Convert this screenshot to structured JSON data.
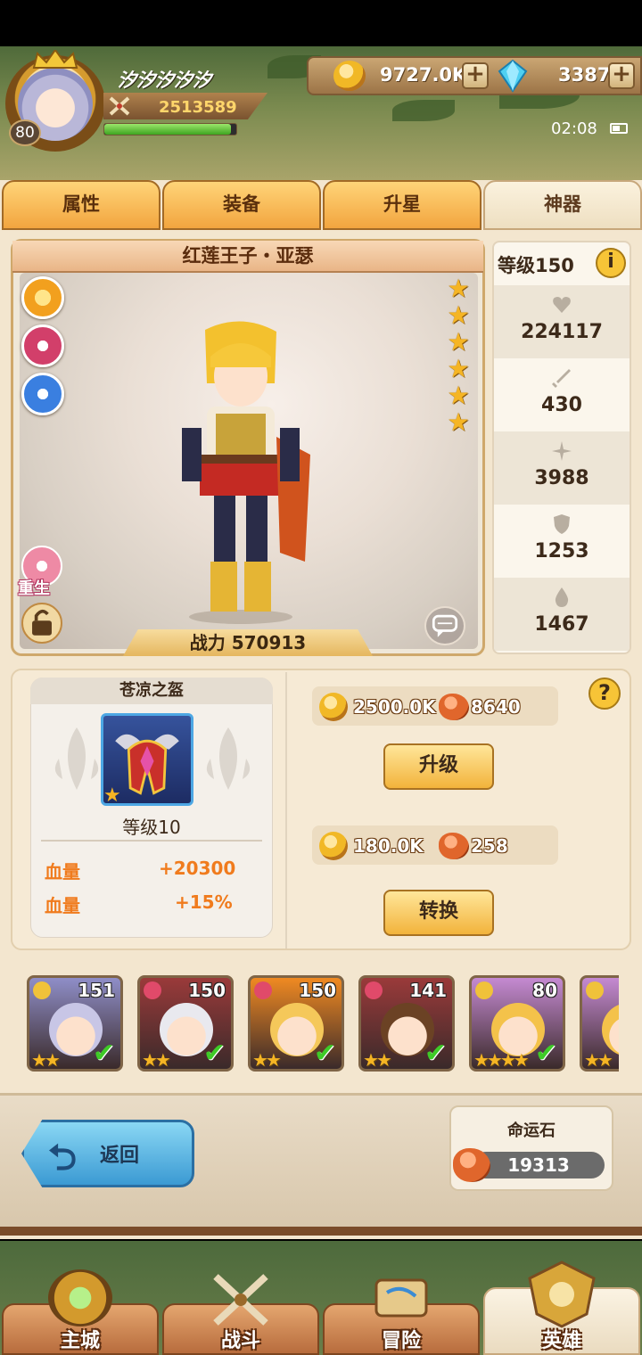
{
  "player": {
    "name": "汐汐汐汐汐",
    "level": "80",
    "power": "2513589",
    "hp_fraction": 0.96
  },
  "resources": {
    "gold": "9727.0K",
    "gems": "3387",
    "plus": "+"
  },
  "status": {
    "time": "02:08",
    "battery_fraction": 0.6
  },
  "tabs": [
    {
      "label": "属性"
    },
    {
      "label": "装备"
    },
    {
      "label": "升星"
    },
    {
      "label": "神器",
      "active": true
    }
  ],
  "hero": {
    "title": "红莲王子・亚瑟",
    "stars": 6,
    "battle_power": "战力 570913",
    "rebirth_label": "重生"
  },
  "stats": {
    "level": "等级150",
    "info": "i",
    "hp": "224117",
    "attack": "430",
    "speed": "3988",
    "defense": "1253",
    "magic": "1467"
  },
  "artifact": {
    "name": "苍凉之盔",
    "level": "等级10",
    "attributes": [
      {
        "name": "血量",
        "value": "+20300"
      },
      {
        "name": "血量",
        "value": "+15%"
      }
    ],
    "help": "?",
    "upgrade": {
      "gold": "2500.0K",
      "stone": "8640",
      "button": "升级"
    },
    "convert": {
      "gold": "180.0K",
      "stone": "258",
      "button": "转换"
    }
  },
  "roster": [
    {
      "level": "151",
      "stars": "★★",
      "badge_color": "#f0c23a",
      "frame": "#8f8ec8",
      "hair": "#c8c6e6"
    },
    {
      "level": "150",
      "stars": "★★",
      "badge_color": "#e04a6a",
      "frame": "#9a3a3a",
      "hair": "#e9e9ef"
    },
    {
      "level": "150",
      "stars": "★★",
      "badge_color": "#e04a6a",
      "frame": "#f08a22",
      "hair": "#f5c85a"
    },
    {
      "level": "141",
      "stars": "★★",
      "badge_color": "#e04a6a",
      "frame": "#9a3a3a",
      "hair": "#6b4224"
    },
    {
      "level": "80",
      "stars": "★★★★",
      "badge_color": "#f0c23a",
      "frame": "#c58ad2",
      "hair": "#f4c24a"
    },
    {
      "level": "",
      "stars": "★★",
      "badge_color": "#f0c23a",
      "frame": "#c58ad2",
      "hair": "#f4c24a"
    }
  ],
  "back": {
    "label": "返回",
    "arrow": "⮌"
  },
  "fate_stone": {
    "title": "命运石",
    "value": "19313"
  },
  "nav": [
    {
      "label": "主城"
    },
    {
      "label": "战斗"
    },
    {
      "label": "冒险"
    },
    {
      "label": "英雄",
      "active": true
    }
  ]
}
